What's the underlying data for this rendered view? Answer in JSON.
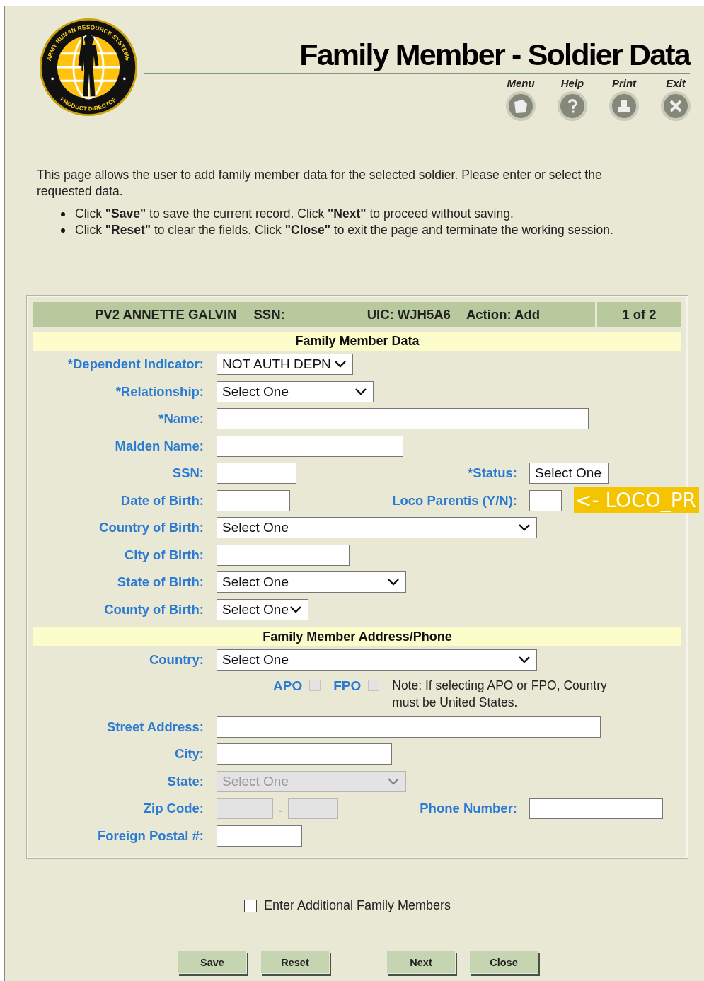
{
  "header": {
    "logo": {
      "top_text": "ARMY HUMAN RESOURCE SYSTEMS",
      "bottom_text": "PRODUCT DIRECTOR"
    },
    "title": "Family Member - Soldier Data",
    "toolbar": [
      {
        "label": "Menu",
        "kind": "menu"
      },
      {
        "label": "Help",
        "kind": "help"
      },
      {
        "label": "Print",
        "kind": "print"
      },
      {
        "label": "Exit",
        "kind": "exit"
      }
    ]
  },
  "intro": {
    "text": "This page allows the user to add family member data for the selected soldier. Please enter or select the requested data.",
    "bullets": [
      "Click **\"Save\"** to save the current record. Click **\"Next\"** to proceed without saving.",
      "Click **\"Reset\"** to clear the fields. Click **\"Close\"** to exit the page and terminate the working session."
    ]
  },
  "record_bar": {
    "soldier": "PV2 ANNETTE GALVIN",
    "ssn_label": "SSN:",
    "uic": "UIC: WJH5A6",
    "action": "Action: Add",
    "page": "1 of 2"
  },
  "sections": [
    {
      "title": "Family Member Data",
      "rows": [
        {
          "kind": "field",
          "label": "*Dependent Indicator:",
          "controls": [
            {
              "kind": "select",
              "value": "NOT AUTH DEPN",
              "disabled": false
            }
          ]
        },
        {
          "kind": "field",
          "label": "*Relationship:",
          "controls": [
            {
              "kind": "select",
              "value": "Select One",
              "disabled": false
            }
          ]
        },
        {
          "kind": "field",
          "label": "*Name:",
          "controls": [
            {
              "kind": "text",
              "disabled": false
            }
          ]
        },
        {
          "kind": "field",
          "label": "Maiden Name:",
          "controls": [
            {
              "kind": "text",
              "disabled": false
            }
          ]
        },
        {
          "kind": "field",
          "label": "SSN:",
          "controls": [
            {
              "kind": "text",
              "disabled": false
            }
          ],
          "side": {
            "label": "*Status:",
            "control": {
              "kind": "select",
              "value": "Select One",
              "disabled": false
            }
          }
        },
        {
          "kind": "field",
          "label": "Date of Birth:",
          "controls": [
            {
              "kind": "text",
              "disabled": false
            }
          ],
          "side": {
            "label": "Loco Parentis (Y/N):",
            "control": {
              "kind": "text",
              "disabled": false
            }
          },
          "annotation": "<- LOCO_PR"
        },
        {
          "kind": "field",
          "label": "Country of Birth:",
          "controls": [
            {
              "kind": "select",
              "value": "Select One",
              "disabled": false
            }
          ]
        },
        {
          "kind": "field",
          "label": "City of Birth:",
          "controls": [
            {
              "kind": "text",
              "disabled": false
            }
          ]
        },
        {
          "kind": "field",
          "label": "State of Birth:",
          "controls": [
            {
              "kind": "select",
              "value": "Select One",
              "disabled": false
            }
          ]
        },
        {
          "kind": "field",
          "label": "County of Birth:",
          "controls": [
            {
              "kind": "select",
              "value": "Select One",
              "disabled": false
            }
          ]
        }
      ]
    },
    {
      "title": "Family Member Address/Phone",
      "rows": [
        {
          "kind": "field",
          "label": "Country:",
          "controls": [
            {
              "kind": "select",
              "value": "Select One",
              "disabled": false
            }
          ]
        },
        {
          "kind": "checks",
          "checks": [
            {
              "label": "APO",
              "checked": false,
              "disabled": true
            },
            {
              "label": "FPO",
              "checked": false,
              "disabled": true
            }
          ],
          "note": "Note: If selecting APO or FPO, Country must be United States."
        },
        {
          "kind": "field",
          "label": "Street Address:",
          "controls": [
            {
              "kind": "text",
              "disabled": false
            }
          ]
        },
        {
          "kind": "field",
          "label": "City:",
          "controls": [
            {
              "kind": "text",
              "disabled": false
            }
          ]
        },
        {
          "kind": "field",
          "label": "State:",
          "controls": [
            {
              "kind": "select",
              "value": "Select One",
              "disabled": true
            }
          ]
        },
        {
          "kind": "field",
          "label": "Zip Code:",
          "controls": [
            {
              "kind": "text",
              "disabled": true
            },
            {
              "kind": "text",
              "disabled": true
            }
          ],
          "separator": "-",
          "side": {
            "label": "Phone Number:",
            "control": {
              "kind": "text",
              "disabled": false
            }
          }
        },
        {
          "kind": "field",
          "label": "Foreign Postal #:",
          "controls": [
            {
              "kind": "text",
              "disabled": false
            }
          ]
        }
      ]
    }
  ],
  "additional": {
    "label": "Enter Additional Family Members",
    "checked": false
  },
  "buttons": [
    "Save",
    "Reset",
    "Next",
    "Close"
  ]
}
